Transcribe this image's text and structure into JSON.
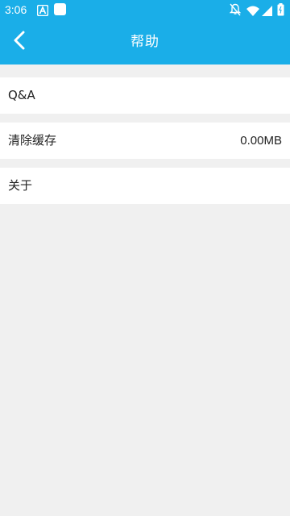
{
  "status_bar": {
    "time": "3:06",
    "icons": [
      "a-icon",
      "notification-square-icon",
      "notifications-off-icon",
      "wifi-icon",
      "cell-signal-icon",
      "battery-icon"
    ]
  },
  "app_bar": {
    "back_icon": "chevron-left-icon",
    "title": "帮助"
  },
  "menu": [
    {
      "label": "Q&A",
      "value": ""
    },
    {
      "label": "清除缓存",
      "value": "0.00MB"
    },
    {
      "label": "关于",
      "value": ""
    }
  ],
  "colors": {
    "accent": "#1aaee8",
    "background": "#f0f0f0",
    "row_background": "#ffffff",
    "text": "#222222"
  }
}
